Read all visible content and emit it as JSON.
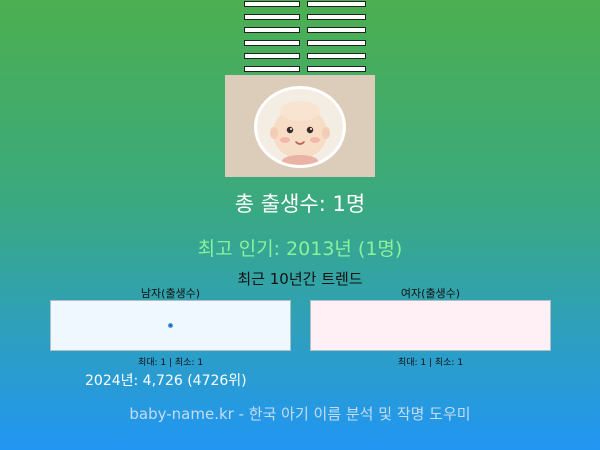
{
  "hexagram": {
    "icon": "hexagram-icon",
    "lines": [
      "broken",
      "broken",
      "broken",
      "broken",
      "broken",
      "broken"
    ]
  },
  "avatar": {
    "icon": "baby-face-icon"
  },
  "summary": {
    "total_births": "총 출생수: 1명",
    "peak_popularity": "최고 인기: 2013년 (1명)"
  },
  "trend": {
    "title": "최근 10년간 트렌드",
    "male": {
      "label": "남자(출생수)",
      "stats": "최대: 1 | 최소: 1"
    },
    "female": {
      "label": "여자(출생수)",
      "stats": "최대: 1 | 최소: 1"
    }
  },
  "year_stat": "2024년: 4,726 (4726위)",
  "footer": "baby-name.kr - 한국 아기 이름 분석 및 작명 도우미",
  "colors": {
    "gradient_top": "#4caf50",
    "gradient_bottom": "#2196f3",
    "peak_text": "#8cf29a",
    "male_box": "#f0f8ff",
    "female_box": "#fff0f5"
  }
}
